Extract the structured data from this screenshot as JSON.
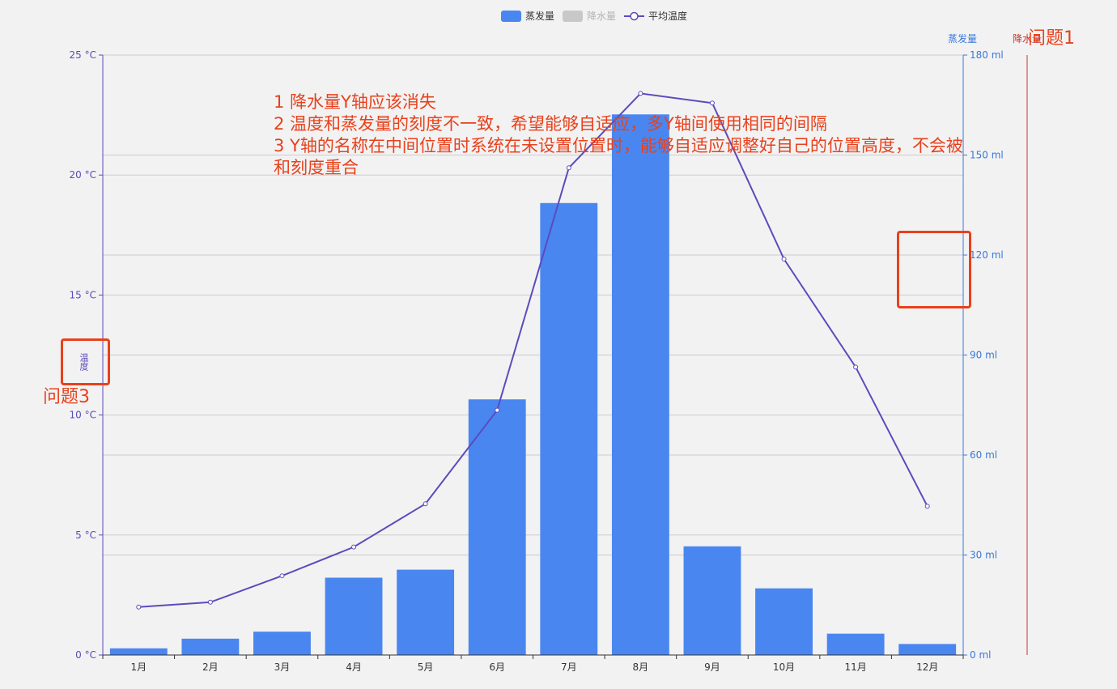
{
  "legend": {
    "items": [
      {
        "label": "蒸发量",
        "color": "#4a86f0",
        "kind": "bar",
        "active": true
      },
      {
        "label": "降水量",
        "color": "#c8c8c8",
        "kind": "bar",
        "active": false
      },
      {
        "label": "平均温度",
        "color": "#5b4bbd",
        "kind": "line",
        "active": true
      }
    ]
  },
  "axes": {
    "left": {
      "name": "温度",
      "ticks": [
        "0 °C",
        "5 °C",
        "10 °C",
        "15 °C",
        "20 °C",
        "25 °C"
      ],
      "color": "#5b4bbd"
    },
    "right1": {
      "name": "蒸发量",
      "ticks": [
        "0 ml",
        "30 ml",
        "60 ml",
        "90 ml",
        "120 ml",
        "150 ml",
        "180 ml"
      ],
      "color": "#3a78d9"
    },
    "right2": {
      "name": "降水量",
      "color": "#c23531"
    }
  },
  "annotations": {
    "lines": [
      "1 降水量Y轴应该消失",
      "2 温度和蒸发量的刻度不一致，希望能够自适应，多Y轴间使用相同的间隔",
      "3 Y轴的名称在中间位置时系统在未设置位置时，能够自适应调整好自己的位置高度，不会被",
      "和刻度重合"
    ],
    "problem1": "问题1",
    "problem3": "问题3",
    "color": "#e8411c"
  },
  "chart_data": {
    "type": "bar",
    "categories": [
      "1月",
      "2月",
      "3月",
      "4月",
      "5月",
      "6月",
      "7月",
      "8月",
      "9月",
      "10月",
      "11月",
      "12月"
    ],
    "series": [
      {
        "name": "蒸发量",
        "type": "bar",
        "axis": "right",
        "values": [
          2,
          4.9,
          7,
          23.2,
          25.6,
          76.7,
          135.6,
          162.2,
          32.6,
          20,
          6.4,
          3.3
        ],
        "color": "#4a86f0"
      },
      {
        "name": "平均温度",
        "type": "line",
        "axis": "left",
        "values": [
          2.0,
          2.2,
          3.3,
          4.5,
          6.3,
          10.2,
          20.3,
          23.4,
          23.0,
          16.5,
          12.0,
          6.2
        ],
        "color": "#5b4bbd"
      }
    ],
    "ylim_left": [
      0,
      25
    ],
    "ylim_right": [
      0,
      180
    ],
    "grid": true
  }
}
